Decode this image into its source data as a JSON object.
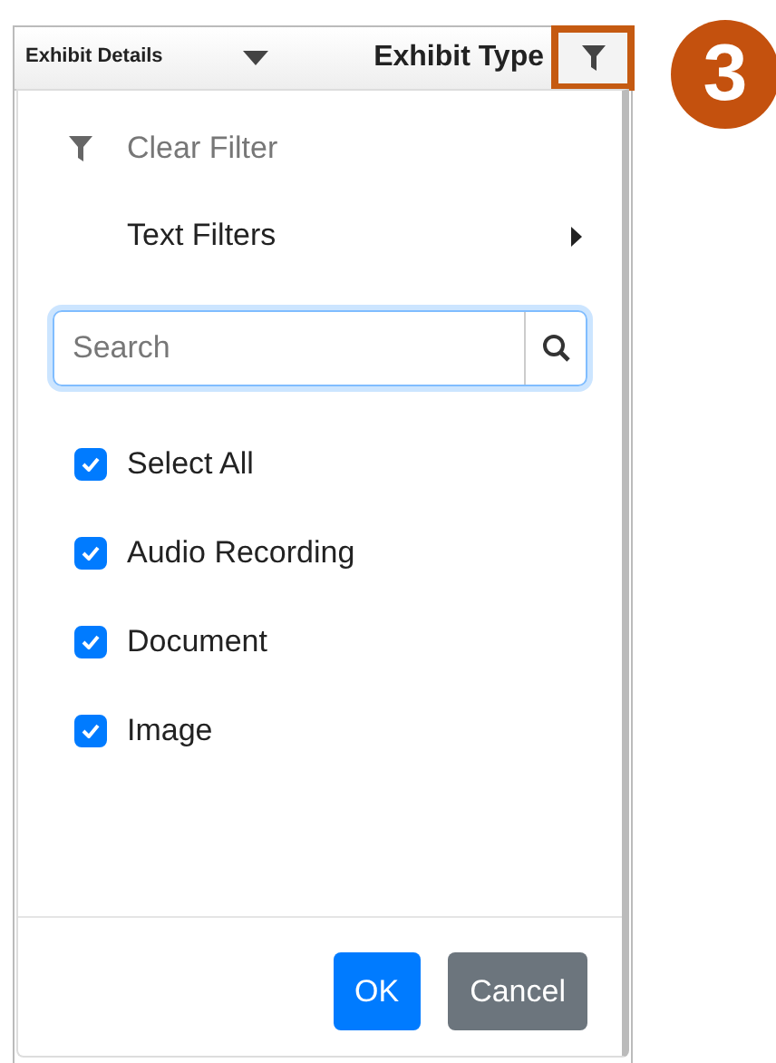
{
  "grid_header": {
    "columns": [
      {
        "label": "Exhibit Details",
        "sorted": true
      },
      {
        "label": "Exhibit Type",
        "filter_highlighted": true
      }
    ]
  },
  "step_badge": "3",
  "filter_menu": {
    "items": [
      {
        "kind": "action",
        "label": "Clear Filter",
        "disabled": true
      },
      {
        "kind": "submenu",
        "label": "Text Filters",
        "disabled": false
      }
    ],
    "search": {
      "placeholder": "Search"
    },
    "options": [
      {
        "label": "Select All",
        "checked": true
      },
      {
        "label": "Audio Recording",
        "checked": true
      },
      {
        "label": "Document",
        "checked": true
      },
      {
        "label": "Image",
        "checked": true
      }
    ],
    "buttons": [
      {
        "label": "OK",
        "kind": "primary"
      },
      {
        "label": "Cancel",
        "kind": "secondary"
      }
    ]
  }
}
